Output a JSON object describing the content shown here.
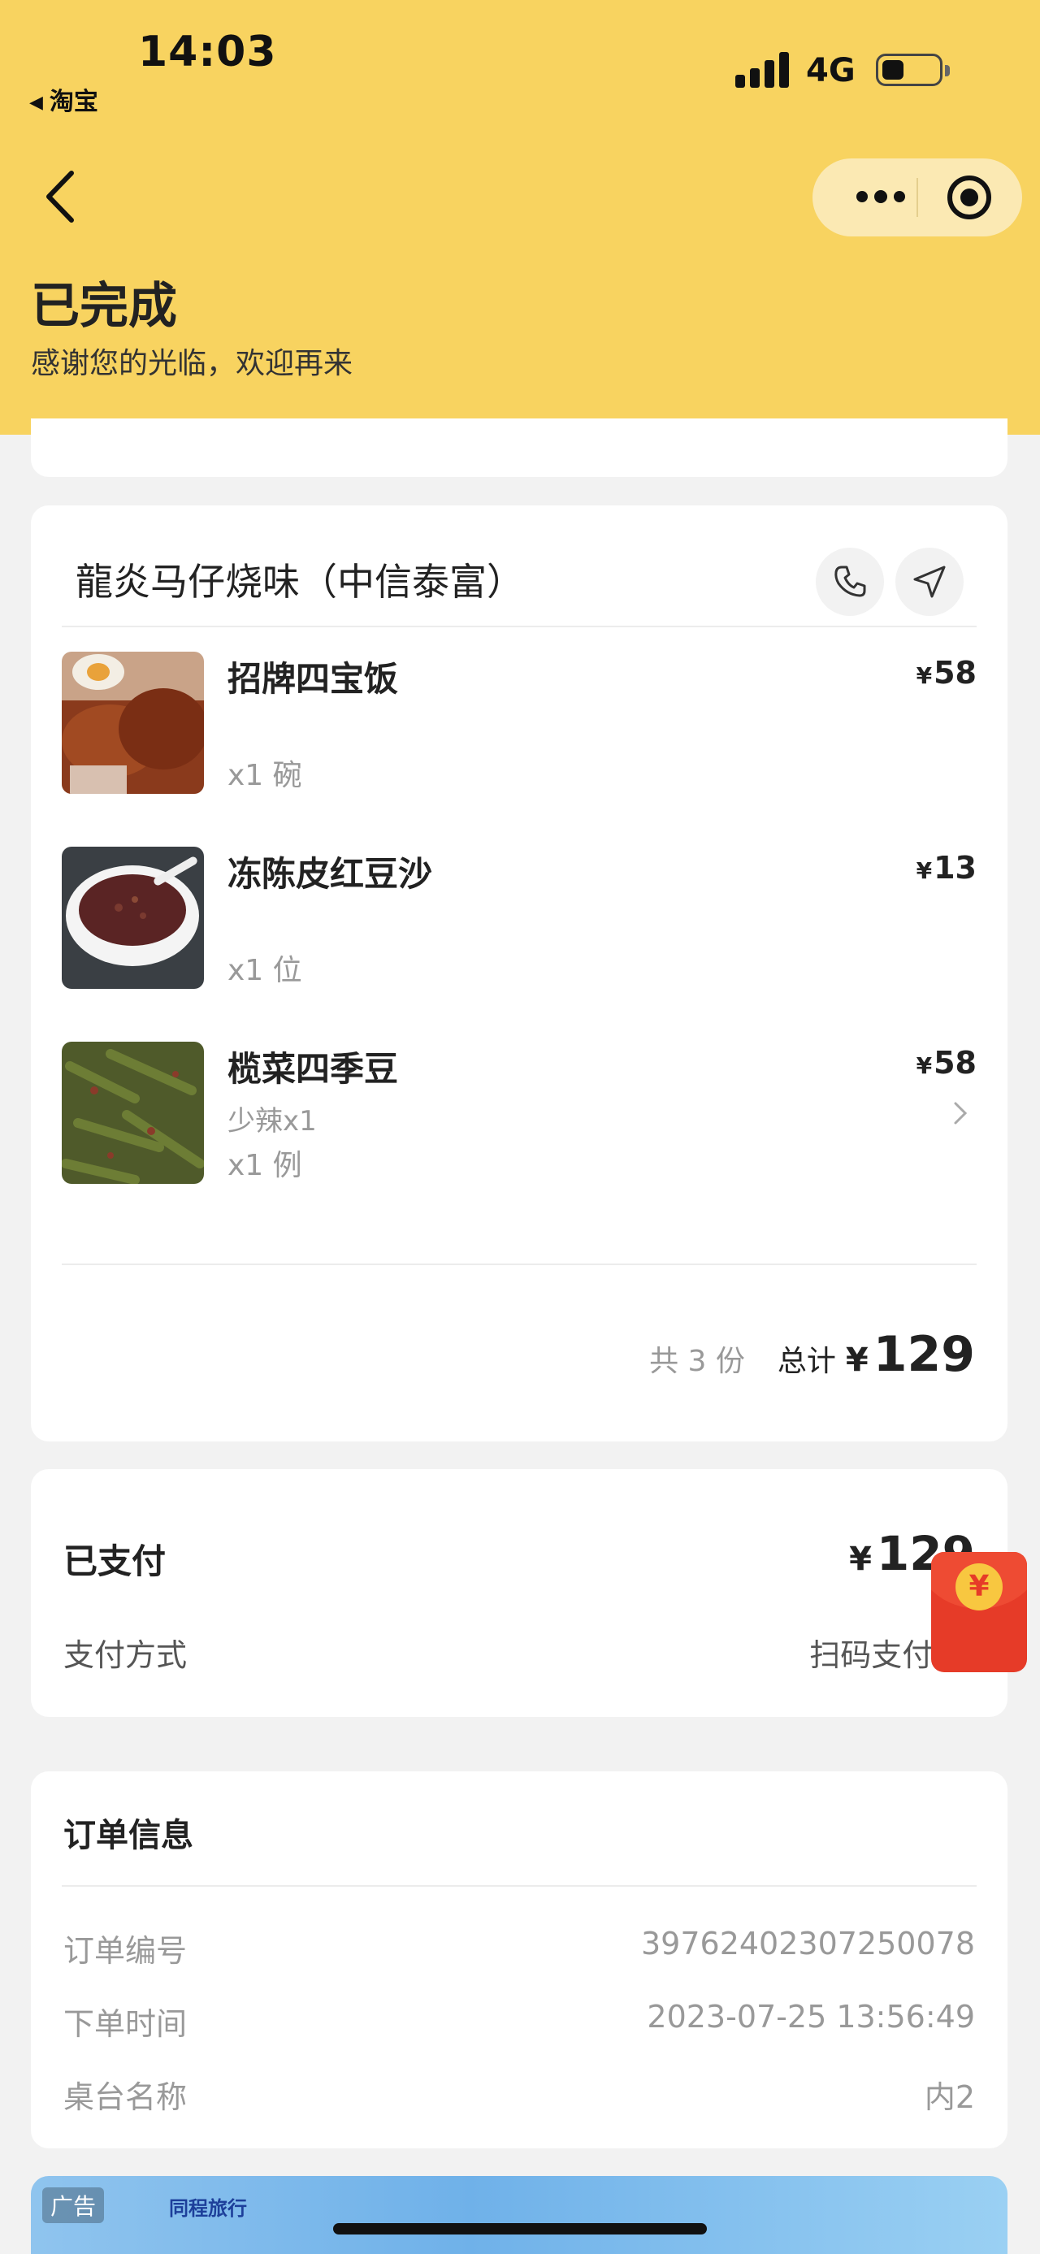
{
  "status_bar": {
    "time": "14:03",
    "back_app": "淘宝",
    "network": "4G"
  },
  "header": {
    "order_status": "已完成",
    "subtitle": "感谢您的光临，欢迎再来"
  },
  "restaurant": {
    "name": "龍炎马仔烧味（中信泰富）"
  },
  "dishes": [
    {
      "name": "招牌四宝饭",
      "price": "58",
      "spec": "",
      "qty": "x1 碗"
    },
    {
      "name": "冻陈皮红豆沙",
      "price": "13",
      "spec": "",
      "qty": "x1 位"
    },
    {
      "name": "榄菜四季豆",
      "price": "58",
      "spec": "少辣x1",
      "qty": "x1 例"
    }
  ],
  "currency_symbol": "¥",
  "summary": {
    "count": "共 3 份",
    "total_label": "总计",
    "total_amount": "129"
  },
  "payment": {
    "paid_label": "已支付",
    "paid_amount": "129",
    "method_label": "支付方式",
    "method_value": "扫码支付-微"
  },
  "order_info": {
    "title": "订单信息",
    "rows": [
      {
        "label": "订单编号",
        "value": "39762402307250078"
      },
      {
        "label": "下单时间",
        "value": "2023-07-25 13:56:49"
      },
      {
        "label": "桌台名称",
        "value": "内2"
      }
    ]
  },
  "ad": {
    "tag": "广告",
    "brand": "同程旅行"
  },
  "colors": {
    "header_bg": "#f8d360",
    "page_bg": "#f2f2f2",
    "redpacket": "#e63b28"
  }
}
